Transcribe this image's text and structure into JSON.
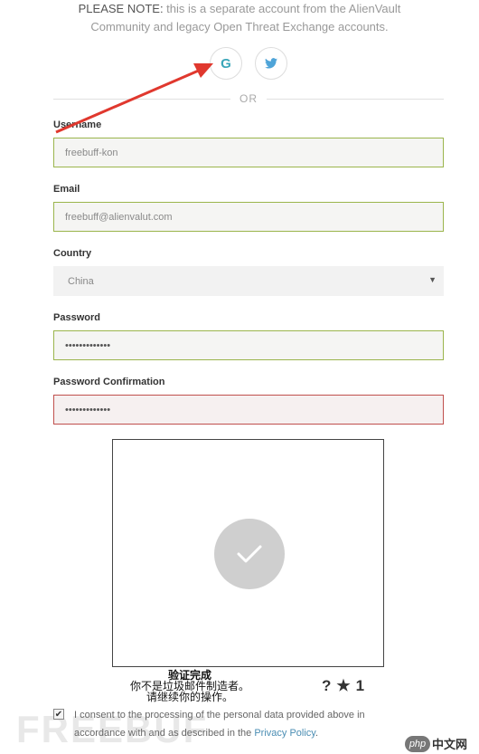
{
  "notice": {
    "strong": "PLEASE NOTE:",
    "line1_rest": " this is a separate account from the AlienVault",
    "line2": "Community and legacy Open Threat Exchange accounts."
  },
  "social": {
    "google_glyph": "G",
    "twitter_icon": "twitter-icon"
  },
  "divider_text": "OR",
  "form": {
    "username_label": "Username",
    "username_value": "freebuff-kon",
    "email_label": "Email",
    "email_value": "freebuff@alienvalut.com",
    "country_label": "Country",
    "country_value": "China",
    "password_label": "Password",
    "password_value": "•••••••••••••",
    "confirm_label": "Password Confirmation",
    "confirm_value": "•••••••••••••"
  },
  "captcha": {
    "line1": "验证完成",
    "line2": "你不是垃圾邮件制造者。",
    "line3": "请继续你的操作。",
    "help_glyph": "?",
    "star_glyph": "★",
    "number": "1"
  },
  "consent": {
    "text": "I consent to the processing of the personal data provided above in accordance with and as described in the ",
    "link": "Privacy Policy",
    "end": "."
  },
  "watermark": {
    "free": "FREEBUF",
    "php": "php",
    "cn": "中文网"
  },
  "colors": {
    "valid_border": "#9bb54c",
    "error_border": "#c0504d",
    "arrow": "#e0382e",
    "link": "#4a8db3"
  }
}
